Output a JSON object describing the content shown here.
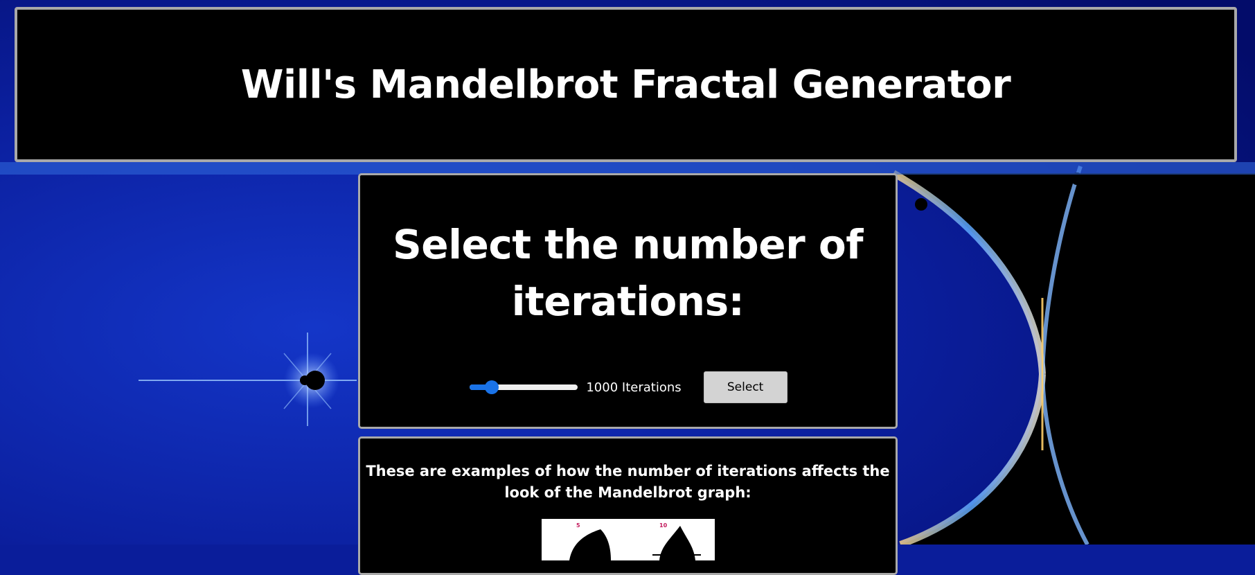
{
  "header": {
    "title": "Will's Mandelbrot Fractal Generator"
  },
  "iterations_panel": {
    "heading": "Select the number of iterations:",
    "slider_value_fraction": 0.2,
    "iterations_label": "1000 Iterations",
    "select_button": "Select"
  },
  "examples_panel": {
    "text": "These are examples of how the number of iterations affects the look of the Mandelbrot graph:",
    "thumb_captions": [
      "5",
      "10"
    ]
  },
  "colors": {
    "accent": "#1a73e8",
    "panel_bg": "#000000",
    "panel_border": "#a9a9a9",
    "background_blue": "#0a1d9a"
  }
}
